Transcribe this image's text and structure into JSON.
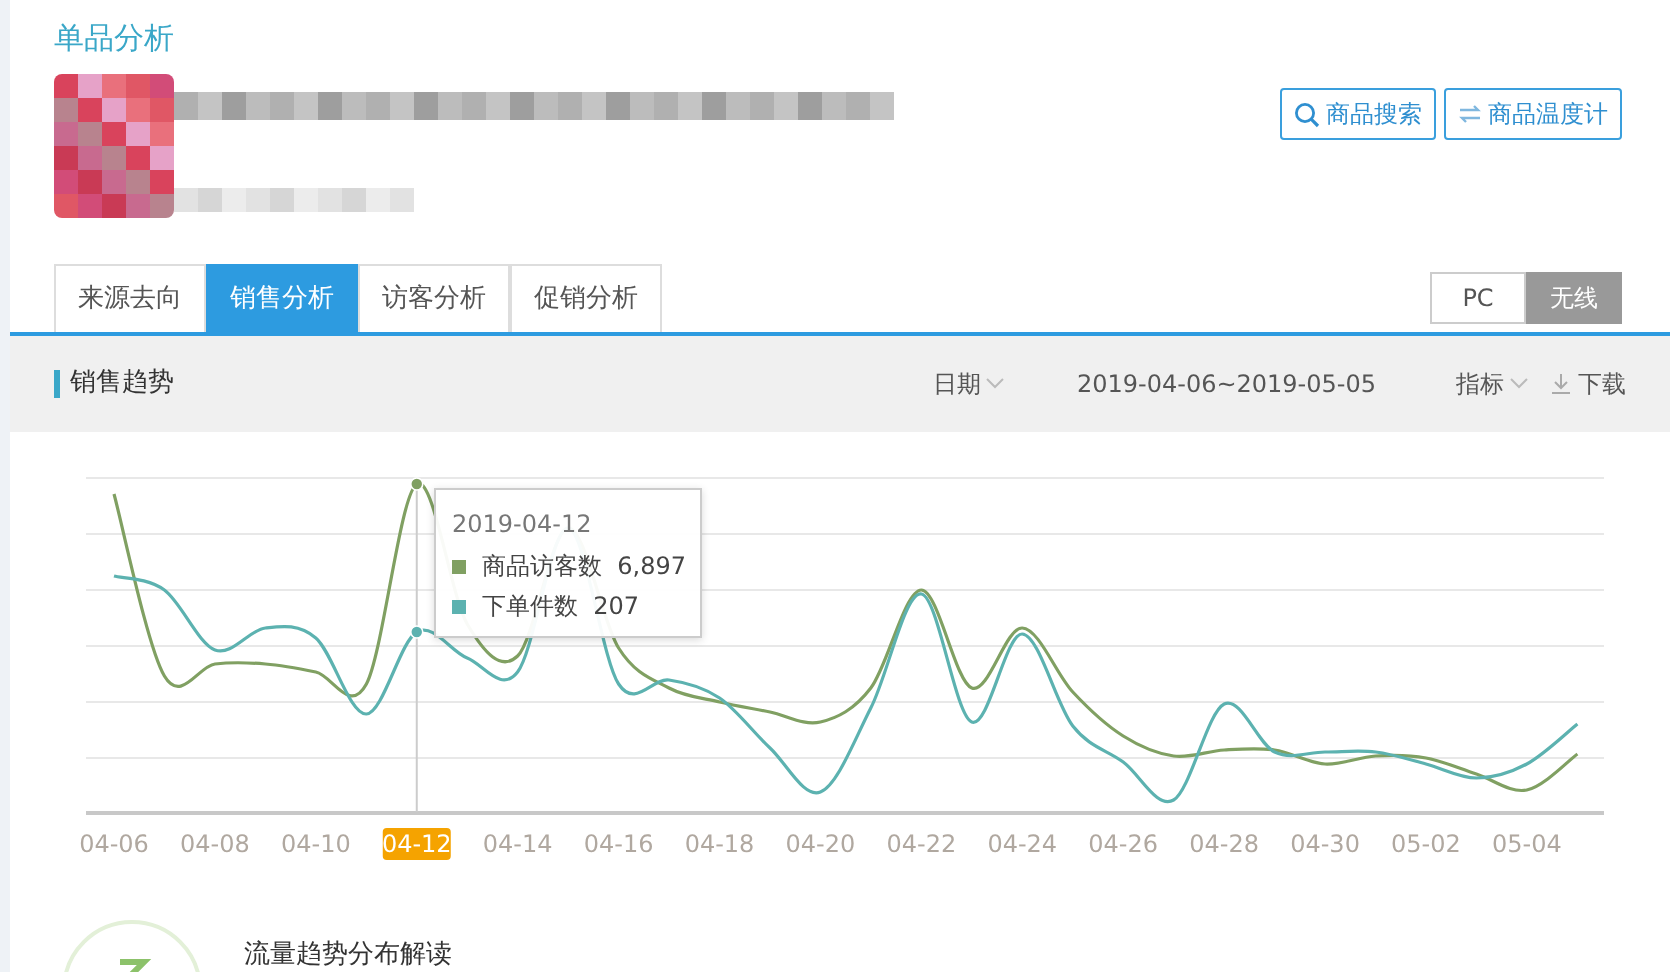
{
  "page_title": "单品分析",
  "header_buttons": [
    {
      "label": "商品搜索",
      "kind": "search"
    },
    {
      "label": "商品温度计",
      "kind": "swap"
    }
  ],
  "tabs": [
    {
      "label": "来源去向",
      "selected": false
    },
    {
      "label": "销售分析",
      "selected": true
    },
    {
      "label": "访客分析",
      "selected": false
    },
    {
      "label": "促销分析",
      "selected": false
    }
  ],
  "platform_toggle": [
    {
      "label": "PC",
      "selected": false
    },
    {
      "label": "无线",
      "selected": true
    }
  ],
  "trend_panel": {
    "title": "销售趋势",
    "date_filter": "日期",
    "date_range": "2019-04-06~2019-05-05",
    "metric_filter": "指标",
    "download": "下载",
    "chart": {
      "x_labels": [
        {
          "label": "04-06",
          "selected": false
        },
        {
          "label": "04-08",
          "selected": false
        },
        {
          "label": "04-10",
          "selected": false
        },
        {
          "label": "04-12",
          "selected": true
        },
        {
          "label": "04-14",
          "selected": false
        },
        {
          "label": "04-16",
          "selected": false
        },
        {
          "label": "04-18",
          "selected": false
        },
        {
          "label": "04-20",
          "selected": false
        },
        {
          "label": "04-22",
          "selected": false
        },
        {
          "label": "04-24",
          "selected": false
        },
        {
          "label": "04-26",
          "selected": false
        },
        {
          "label": "04-28",
          "selected": false
        },
        {
          "label": "04-30",
          "selected": false
        },
        {
          "label": "05-02",
          "selected": false
        },
        {
          "label": "05-04",
          "selected": false
        }
      ],
      "tooltip": {
        "title": "2019-04-12",
        "items": [
          {
            "name": "商品访客数",
            "value": "6,897",
            "color": "#80a062"
          },
          {
            "name": "下单件数",
            "value": "207",
            "color": "#5cb2b0"
          }
        ]
      }
    }
  },
  "insight": {
    "title": "流量趋势分布解读"
  }
}
